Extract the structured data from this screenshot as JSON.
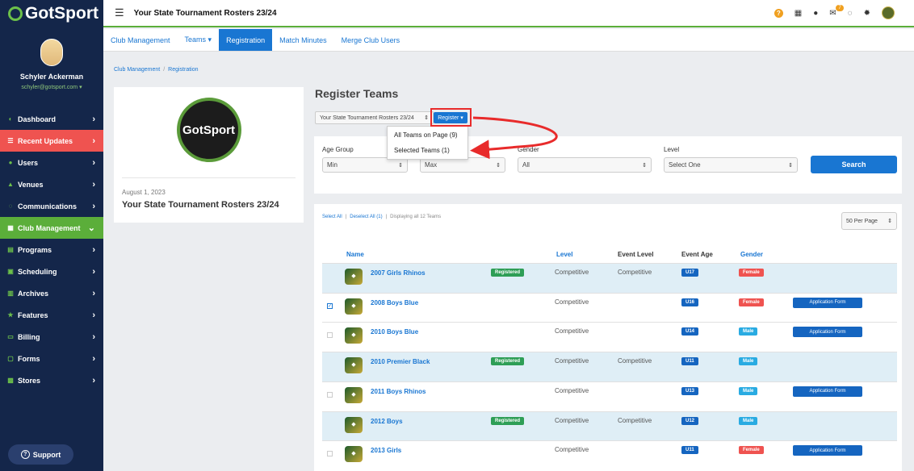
{
  "brand": {
    "name": "GotSport"
  },
  "user": {
    "name": "Schyler Ackerman",
    "email": "schyler@gotsport.com"
  },
  "sidebar": {
    "items": [
      {
        "label": "Dashboard",
        "icon": "dashboard-icon"
      },
      {
        "label": "Recent Updates",
        "icon": "updates-icon"
      },
      {
        "label": "Users",
        "icon": "users-icon"
      },
      {
        "label": "Venues",
        "icon": "venues-icon"
      },
      {
        "label": "Communications",
        "icon": "communications-icon"
      },
      {
        "label": "Club Management",
        "icon": "club-management-icon"
      },
      {
        "label": "Programs",
        "icon": "programs-icon"
      },
      {
        "label": "Scheduling",
        "icon": "scheduling-icon"
      },
      {
        "label": "Archives",
        "icon": "archives-icon"
      },
      {
        "label": "Features",
        "icon": "features-icon"
      },
      {
        "label": "Billing",
        "icon": "billing-icon"
      },
      {
        "label": "Forms",
        "icon": "forms-icon"
      },
      {
        "label": "Stores",
        "icon": "stores-icon"
      }
    ],
    "support_label": "Support"
  },
  "header": {
    "title": "Your State Tournament Rosters 23/24",
    "notification_count": "7"
  },
  "subnav": {
    "tabs": [
      "Club Management",
      "Teams ▾",
      "Registration",
      "Match Minutes",
      "Merge Club Users"
    ]
  },
  "breadcrumb": {
    "items": [
      "Club Management",
      "Registration"
    ]
  },
  "club_card": {
    "logo_text": "GotSport",
    "date": "August 1, 2023",
    "name": "Your State Tournament Rosters 23/24"
  },
  "register": {
    "title": "Register Teams",
    "season": "Your State Tournament Rosters 23/24",
    "button": "Register ▾",
    "dropdown": [
      "All Teams on Page (9)",
      "Selected Teams (1)"
    ]
  },
  "filters": {
    "age_group_label": "Age Group",
    "gender_label": "Gender",
    "level_label": "Level",
    "min": "Min",
    "max": "Max",
    "gender_value": "All",
    "level_value": "Select One",
    "search_label": "Search"
  },
  "teams": {
    "select_all": "Select All",
    "deselect_all": "Deselect All (1)",
    "displaying_prefix": "Displaying",
    "displaying_count": "all 12 Teams",
    "per_page": "50 Per Page",
    "columns": {
      "name": "Name",
      "level": "Level",
      "event_level": "Event Level",
      "event_age": "Event Age",
      "gender": "Gender"
    },
    "registered_label": "Registered",
    "application_label": "Application Form",
    "rows": [
      {
        "name": "2007 Girls Rhinos",
        "registered": true,
        "level": "Competitive",
        "event_level": "Competitive",
        "age": "U17",
        "gender": "Female",
        "checked": false
      },
      {
        "name": "2008 Boys Blue",
        "registered": false,
        "level": "Competitive",
        "event_level": "",
        "age": "U16",
        "gender": "Female",
        "checked": true
      },
      {
        "name": "2010 Boys Blue",
        "registered": false,
        "level": "Competitive",
        "event_level": "",
        "age": "U14",
        "gender": "Male",
        "checked": false
      },
      {
        "name": "2010 Premier Black",
        "registered": true,
        "level": "Competitive",
        "event_level": "Competitive",
        "age": "U11",
        "gender": "Male",
        "checked": false
      },
      {
        "name": "2011 Boys Rhinos",
        "registered": false,
        "level": "Competitive",
        "event_level": "",
        "age": "U13",
        "gender": "Male",
        "checked": false
      },
      {
        "name": "2012 Boys",
        "registered": true,
        "level": "Competitive",
        "event_level": "Competitive",
        "age": "U12",
        "gender": "Male",
        "checked": false
      },
      {
        "name": "2013 Girls",
        "registered": false,
        "level": "Competitive",
        "event_level": "",
        "age": "U11",
        "gender": "Female",
        "checked": false
      }
    ]
  },
  "colors": {
    "sidebar": "#14264a",
    "accent": "#1976d2",
    "active_red": "#ef5350",
    "active_green": "#5bae3a",
    "annotation": "#e82b2b"
  }
}
